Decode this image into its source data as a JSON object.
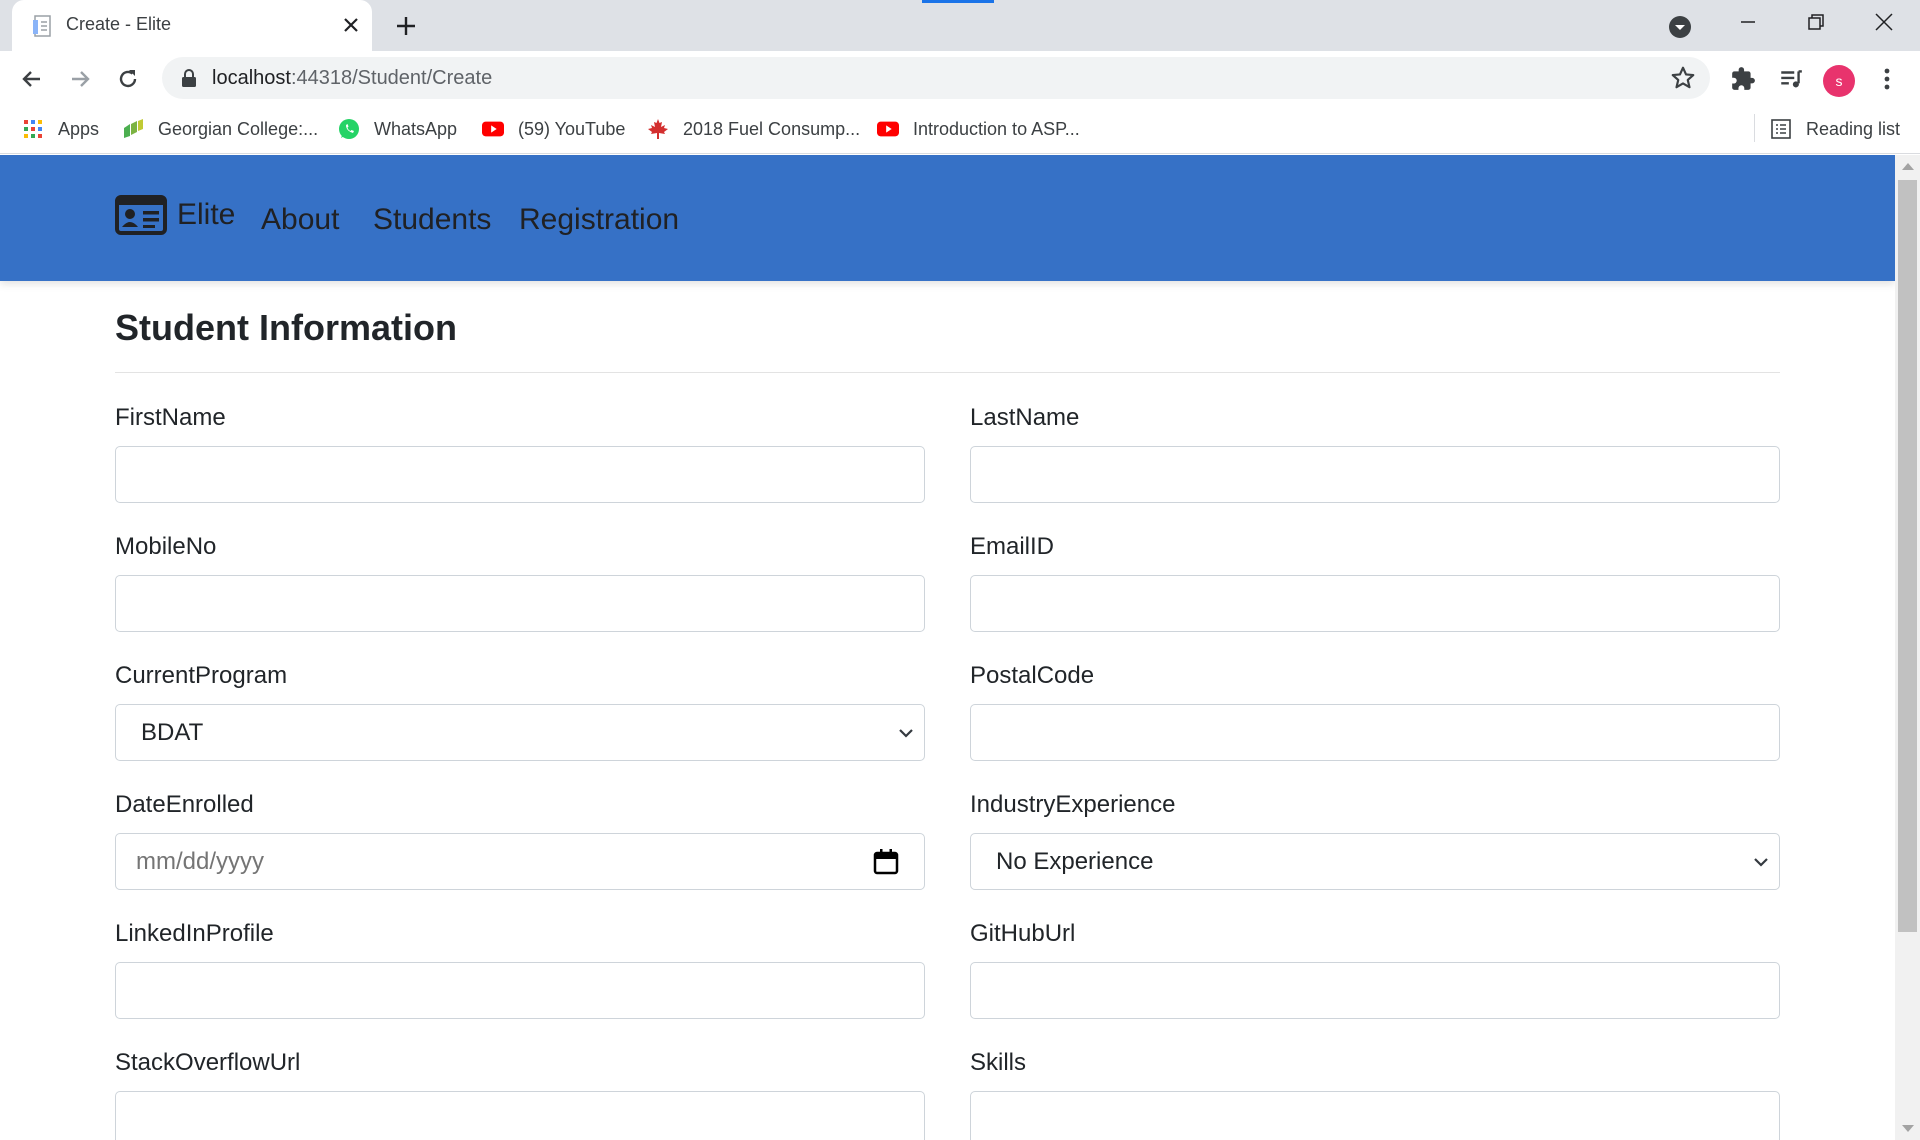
{
  "browser": {
    "tab_title": "Create - Elite",
    "url_host": "localhost",
    "url_rest": ":44318/Student/Create",
    "avatar_letter": "s",
    "bookmarks": [
      {
        "label": "Apps",
        "icon": "apps-grid-icon"
      },
      {
        "label": "Georgian College:...",
        "icon": "georgian-college-icon"
      },
      {
        "label": "WhatsApp",
        "icon": "whatsapp-icon"
      },
      {
        "label": "(59) YouTube",
        "icon": "youtube-icon"
      },
      {
        "label": "2018 Fuel Consump...",
        "icon": "maple-leaf-icon"
      },
      {
        "label": "Introduction to ASP...",
        "icon": "youtube-icon"
      }
    ],
    "reading_list": "Reading list"
  },
  "navbar": {
    "brand": "Elite",
    "links": [
      "About",
      "Students",
      "Registration"
    ],
    "color": "#3671c6"
  },
  "form": {
    "title": "Student Information",
    "labels": {
      "first_name": "FirstName",
      "last_name": "LastName",
      "mobile_no": "MobileNo",
      "email_id": "EmailID",
      "current_program": "CurrentProgram",
      "postal_code": "PostalCode",
      "date_enrolled": "DateEnrolled",
      "industry_experience": "IndustryExperience",
      "linkedin_profile": "LinkedInProfile",
      "github_url": "GitHubUrl",
      "stackoverflow_url": "StackOverflowUrl",
      "skills": "Skills"
    },
    "values": {
      "first_name": "",
      "last_name": "",
      "mobile_no": "",
      "email_id": "",
      "current_program": "BDAT",
      "postal_code": "",
      "date_enrolled_placeholder": "mm/dd/yyyy",
      "industry_experience": "No Experience",
      "linkedin_profile": "",
      "github_url": "",
      "stackoverflow_url": "",
      "skills": ""
    }
  }
}
